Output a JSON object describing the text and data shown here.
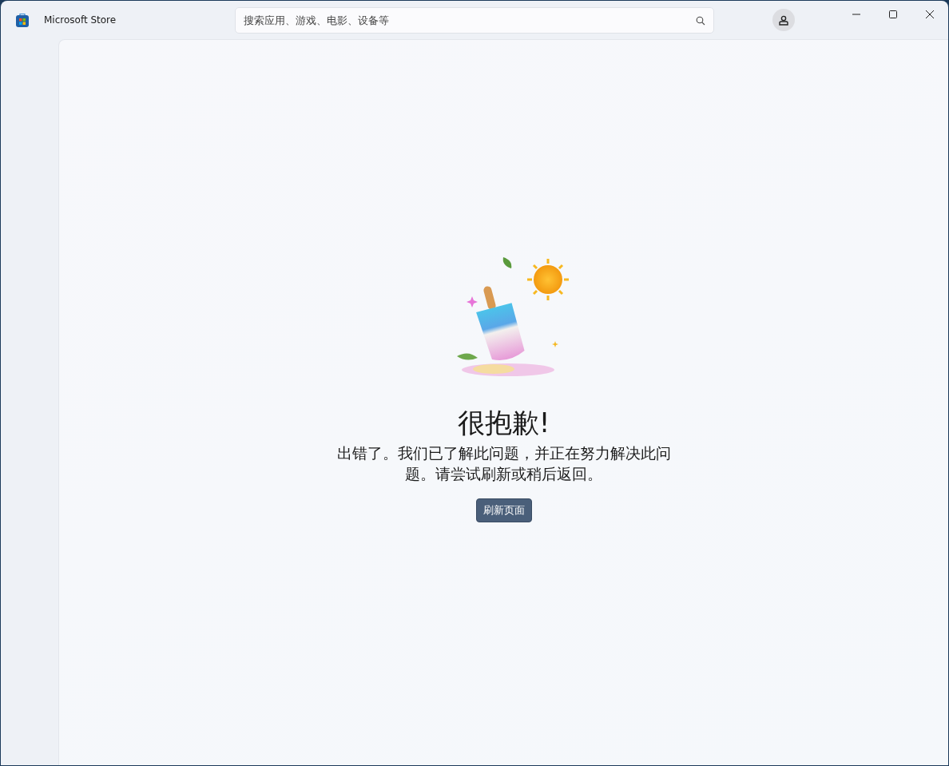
{
  "window": {
    "title": "Microsoft Store"
  },
  "search": {
    "placeholder": "搜索应用、游戏、电影、设备等"
  },
  "error": {
    "heading": "很抱歉!",
    "message": "出错了。我们已了解此问题，并正在努力解决此问题。请尝试刷新或稍后返回。",
    "button": "刷新页面"
  }
}
